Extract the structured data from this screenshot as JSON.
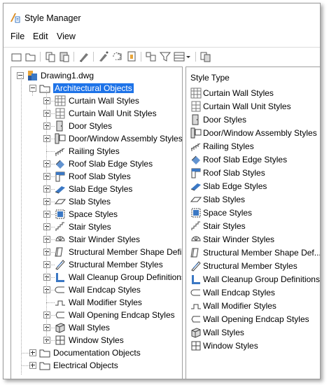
{
  "window": {
    "title": "Style Manager",
    "title_icon": "style-manager-icon"
  },
  "menu": [
    {
      "label": "File"
    },
    {
      "label": "Edit"
    },
    {
      "label": "View"
    }
  ],
  "toolbar": [
    {
      "name": "new-icon"
    },
    {
      "name": "open-icon"
    },
    {
      "name": "copy-icon"
    },
    {
      "name": "paste-icon"
    },
    {
      "name": "edit-style-icon"
    },
    {
      "name": "purge-icon"
    },
    {
      "name": "toggle-view-icon"
    },
    {
      "name": "sort-icon"
    },
    {
      "name": "filter-style-type-icon"
    },
    {
      "name": "view-options-icon"
    },
    {
      "name": "inventory-icon"
    }
  ],
  "tree": {
    "root": {
      "label": "Drawing1.dwg",
      "icon": "drawing-icon"
    },
    "category": {
      "label": "Architectural Objects",
      "icon": "folder-open-icon"
    },
    "items": [
      {
        "label": "Curtain Wall Styles",
        "icon": "curtain-wall-icon"
      },
      {
        "label": "Curtain Wall Unit Styles",
        "icon": "curtain-wall-unit-icon"
      },
      {
        "label": "Door Styles",
        "icon": "door-icon"
      },
      {
        "label": "Door/Window Assembly Styles",
        "icon": "door-window-assembly-icon"
      },
      {
        "label": "Railing Styles",
        "icon": "railing-icon"
      },
      {
        "label": "Roof Slab Edge Styles",
        "icon": "roof-slab-edge-icon"
      },
      {
        "label": "Roof Slab Styles",
        "icon": "roof-slab-icon"
      },
      {
        "label": "Slab Edge Styles",
        "icon": "slab-edge-icon"
      },
      {
        "label": "Slab Styles",
        "icon": "slab-icon"
      },
      {
        "label": "Space Styles",
        "icon": "space-icon"
      },
      {
        "label": "Stair Styles",
        "icon": "stair-icon"
      },
      {
        "label": "Stair Winder Styles",
        "icon": "stair-winder-icon"
      },
      {
        "label": "Structural Member Shape Defir",
        "icon": "structural-member-shape-icon"
      },
      {
        "label": "Structural Member Styles",
        "icon": "structural-member-icon"
      },
      {
        "label": "Wall Cleanup Group Definitions",
        "icon": "wall-cleanup-icon"
      },
      {
        "label": "Wall Endcap Styles",
        "icon": "wall-endcap-icon"
      },
      {
        "label": "Wall Modifier Styles",
        "icon": "wall-modifier-icon"
      },
      {
        "label": "Wall Opening Endcap Styles",
        "icon": "wall-opening-endcap-icon"
      },
      {
        "label": "Wall Styles",
        "icon": "wall-icon"
      },
      {
        "label": "Window Styles",
        "icon": "window-icon"
      }
    ],
    "other_categories": [
      {
        "label": "Documentation Objects",
        "icon": "folder-icon"
      },
      {
        "label": "Electrical Objects",
        "icon": "folder-icon"
      }
    ]
  },
  "right_pane": {
    "header": "Style Type",
    "items": [
      {
        "label": "Curtain Wall Styles",
        "icon": "curtain-wall-icon"
      },
      {
        "label": "Curtain Wall Unit Styles",
        "icon": "curtain-wall-unit-icon"
      },
      {
        "label": "Door Styles",
        "icon": "door-icon"
      },
      {
        "label": "Door/Window Assembly Styles",
        "icon": "door-window-assembly-icon"
      },
      {
        "label": "Railing Styles",
        "icon": "railing-icon"
      },
      {
        "label": "Roof Slab Edge Styles",
        "icon": "roof-slab-edge-icon"
      },
      {
        "label": "Roof Slab Styles",
        "icon": "roof-slab-icon"
      },
      {
        "label": "Slab Edge Styles",
        "icon": "slab-edge-icon"
      },
      {
        "label": "Slab Styles",
        "icon": "slab-icon"
      },
      {
        "label": "Space Styles",
        "icon": "space-icon"
      },
      {
        "label": "Stair Styles",
        "icon": "stair-icon"
      },
      {
        "label": "Stair Winder Styles",
        "icon": "stair-winder-icon"
      },
      {
        "label": "Structural Member Shape Def...",
        "icon": "structural-member-shape-icon"
      },
      {
        "label": "Structural Member Styles",
        "icon": "structural-member-icon"
      },
      {
        "label": "Wall Cleanup Group Definitions",
        "icon": "wall-cleanup-icon"
      },
      {
        "label": "Wall Endcap Styles",
        "icon": "wall-endcap-icon"
      },
      {
        "label": "Wall Modifier Styles",
        "icon": "wall-modifier-icon"
      },
      {
        "label": "Wall Opening Endcap Styles",
        "icon": "wall-opening-endcap-icon"
      },
      {
        "label": "Wall Styles",
        "icon": "wall-icon"
      },
      {
        "label": "Window Styles",
        "icon": "window-icon"
      }
    ]
  },
  "colors": {
    "selection": "#1e73e8",
    "folder": "#f3d27a",
    "icon_blue": "#3b78c4"
  }
}
